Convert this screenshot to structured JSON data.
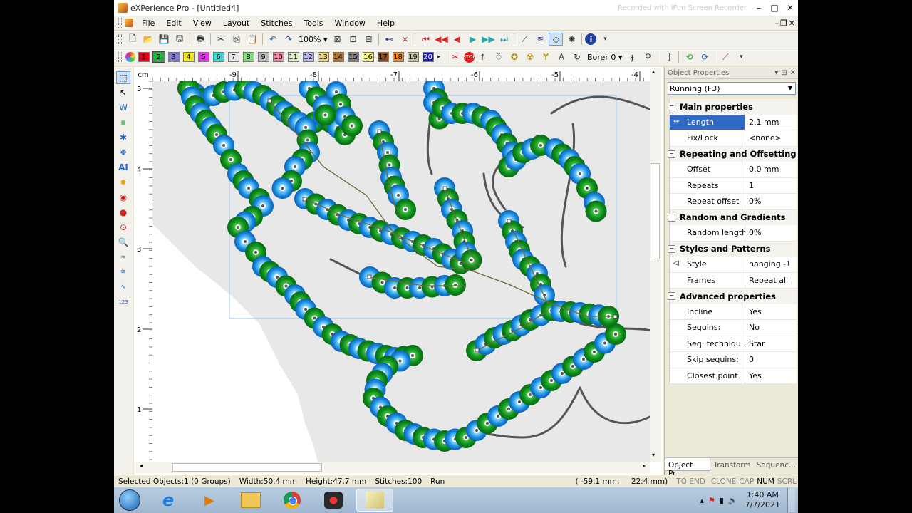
{
  "window": {
    "title": "eXPerience Pro - [Untitled4]",
    "watermark": "Recorded with iFun Screen Recorder",
    "controls": {
      "minimize": "–",
      "maximize": "□",
      "close": "✕"
    }
  },
  "menu": [
    "File",
    "Edit",
    "View",
    "Layout",
    "Stitches",
    "Tools",
    "Window",
    "Help"
  ],
  "mdi_controls": {
    "minimize": "–",
    "restore": "❐",
    "close": "✕"
  },
  "toolbar": {
    "zoom": "100%",
    "borer_label": "Borer 0"
  },
  "colors": [
    {
      "n": "1",
      "c": "#e3001b"
    },
    {
      "n": "2",
      "c": "#19b83a"
    },
    {
      "n": "3",
      "c": "#7c7cd6"
    },
    {
      "n": "4",
      "c": "#f2ea18"
    },
    {
      "n": "5",
      "c": "#e231e2"
    },
    {
      "n": "6",
      "c": "#39d6d6"
    },
    {
      "n": "7",
      "c": "#e8e8e8"
    },
    {
      "n": "8",
      "c": "#7fdc7f"
    },
    {
      "n": "9",
      "c": "#bdbdbd"
    },
    {
      "n": "10",
      "c": "#f08aa2"
    },
    {
      "n": "11",
      "c": "#d8f0c8"
    },
    {
      "n": "12",
      "c": "#b8b8ec"
    },
    {
      "n": "13",
      "c": "#f2d47a"
    },
    {
      "n": "14",
      "c": "#b3742c"
    },
    {
      "n": "15",
      "c": "#7f7f7f"
    },
    {
      "n": "16",
      "c": "#f7f27a"
    },
    {
      "n": "17",
      "c": "#8a4a1e"
    },
    {
      "n": "18",
      "c": "#f08a2a"
    },
    {
      "n": "19",
      "c": "#c8c8a0"
    },
    {
      "n": "20",
      "c": "#1a1aa0"
    }
  ],
  "ruler": {
    "unit": "cm",
    "h_ticks": [
      "-9",
      "-8",
      "-7",
      "-6",
      "-5",
      "-4"
    ],
    "v_ticks": [
      "5",
      "4",
      "3",
      "2",
      "1"
    ]
  },
  "panel": {
    "title": "Object Properties",
    "dropdown": "Running (F3)",
    "sections": [
      {
        "title": "Main properties",
        "rows": [
          {
            "k": "Length",
            "v": "2.1 mm",
            "sel": true,
            "icon": "⇔"
          },
          {
            "k": "Fix/Lock",
            "v": "<none>"
          }
        ]
      },
      {
        "title": "Repeating and Offsetting",
        "rows": [
          {
            "k": "Offset",
            "v": "0.0 mm"
          },
          {
            "k": "Repeats",
            "v": "1"
          },
          {
            "k": "Repeat offset",
            "v": "0%"
          }
        ]
      },
      {
        "title": "Random and Gradients",
        "rows": [
          {
            "k": "Random length",
            "v": "0%"
          }
        ]
      },
      {
        "title": "Styles and Patterns",
        "rows": [
          {
            "k": "Style",
            "v": "hanging -1",
            "icon": "◁"
          },
          {
            "k": "Frames",
            "v": "Repeat all"
          }
        ]
      },
      {
        "title": "Advanced properties",
        "rows": [
          {
            "k": "Incline",
            "v": "Yes"
          },
          {
            "k": "Sequins:",
            "v": "No"
          },
          {
            "k": "Seq. techniqu...",
            "v": "Star"
          },
          {
            "k": "Skip sequins:",
            "v": "0"
          },
          {
            "k": "Closest point",
            "v": "Yes"
          }
        ]
      }
    ],
    "tabs": [
      "Object Pr...",
      "Transform",
      "Sequenc..."
    ]
  },
  "status": {
    "selected": "Selected Objects:1 (0 Groups)",
    "width": "Width:50.4 mm",
    "height": "Height:47.7 mm",
    "stitches": "Stitches:100",
    "mode": "Run",
    "coords": "( -59.1 mm,     22.4 mm)",
    "indicators": [
      "TO END",
      "CLONE",
      "CAP",
      "NUM",
      "SCRL"
    ]
  },
  "taskbar": {
    "time": "1:40 AM",
    "date": "7/7/2021"
  }
}
